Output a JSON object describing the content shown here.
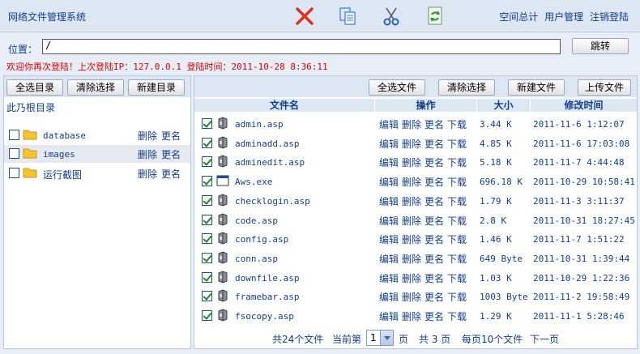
{
  "header": {
    "title": "网络文件管理系统",
    "links": [
      "空间总计",
      "用户管理",
      "注销登陆"
    ],
    "colors": {
      "delete": "#e03020",
      "copy": "#3a7bd5",
      "cut": "#2b63b8",
      "refresh": "#2e9a2e"
    }
  },
  "address": {
    "label": "位置：",
    "value": "/",
    "go_label": "跳转"
  },
  "welcome": {
    "text": "欢迎你再次登陆！上次登陆IP：127.0.0.1   登陆时间：2011-10-28 8:36:11"
  },
  "left": {
    "buttons": [
      "全选目录",
      "清除选择",
      "新建目录"
    ],
    "root_label": "此乃根目录",
    "dirs": [
      {
        "name": "database",
        "delete": "删除",
        "rename": "更名",
        "checked": false
      },
      {
        "name": "images",
        "delete": "删除",
        "rename": "更名",
        "checked": false
      },
      {
        "name": "运行截图",
        "delete": "删除",
        "rename": "更名",
        "checked": false
      }
    ]
  },
  "right": {
    "buttons": [
      "全选文件",
      "清除选择",
      "新建文件",
      "上传文件"
    ],
    "columns": [
      "文件名",
      "操作",
      "大小",
      "修改时间"
    ],
    "ops": [
      "编辑",
      "删除",
      "更名",
      "下载"
    ],
    "files": [
      {
        "name": "admin.asp",
        "size": "3.44 K",
        "date": "2011-11-6 1:12:07",
        "icon": "asp-file-icon"
      },
      {
        "name": "adminadd.asp",
        "size": "4.85 K",
        "date": "2011-11-6 17:03:08",
        "icon": "asp-file-icon"
      },
      {
        "name": "adminedit.asp",
        "size": "5.18 K",
        "date": "2011-11-7 4:44:48",
        "icon": "asp-file-icon"
      },
      {
        "name": "Aws.exe",
        "size": "696.18 K",
        "date": "2011-10-29 10:58:41",
        "icon": "exe-file-icon"
      },
      {
        "name": "checklogin.asp",
        "size": "1.79 K",
        "date": "2011-11-3 3:11:37",
        "icon": "asp-file-icon"
      },
      {
        "name": "code.asp",
        "size": "2.8 K",
        "date": "2011-10-31 18:27:45",
        "icon": "asp-file-icon"
      },
      {
        "name": "config.asp",
        "size": "1.46 K",
        "date": "2011-11-7 1:51:22",
        "icon": "asp-file-icon"
      },
      {
        "name": "conn.asp",
        "size": "649 Byte",
        "date": "2011-10-31 1:39:44",
        "icon": "asp-file-icon"
      },
      {
        "name": "downfile.asp",
        "size": "1.03 K",
        "date": "2011-10-29 1:22:36",
        "icon": "asp-file-icon"
      },
      {
        "name": "framebar.asp",
        "size": "1003 Byte",
        "date": "2011-11-2 19:58:49",
        "icon": "asp-file-icon"
      },
      {
        "name": "fsocopy.asp",
        "size": "1.29 K",
        "date": "2011-11-1 5:28:46",
        "icon": "asp-file-icon"
      }
    ],
    "pager": {
      "total": "共24个文件",
      "current_prefix": "当前第",
      "current_page": "1",
      "page_suffix": "页",
      "pages": "共 3 页",
      "per_page": "每页10个文件",
      "next": "下一页"
    }
  }
}
